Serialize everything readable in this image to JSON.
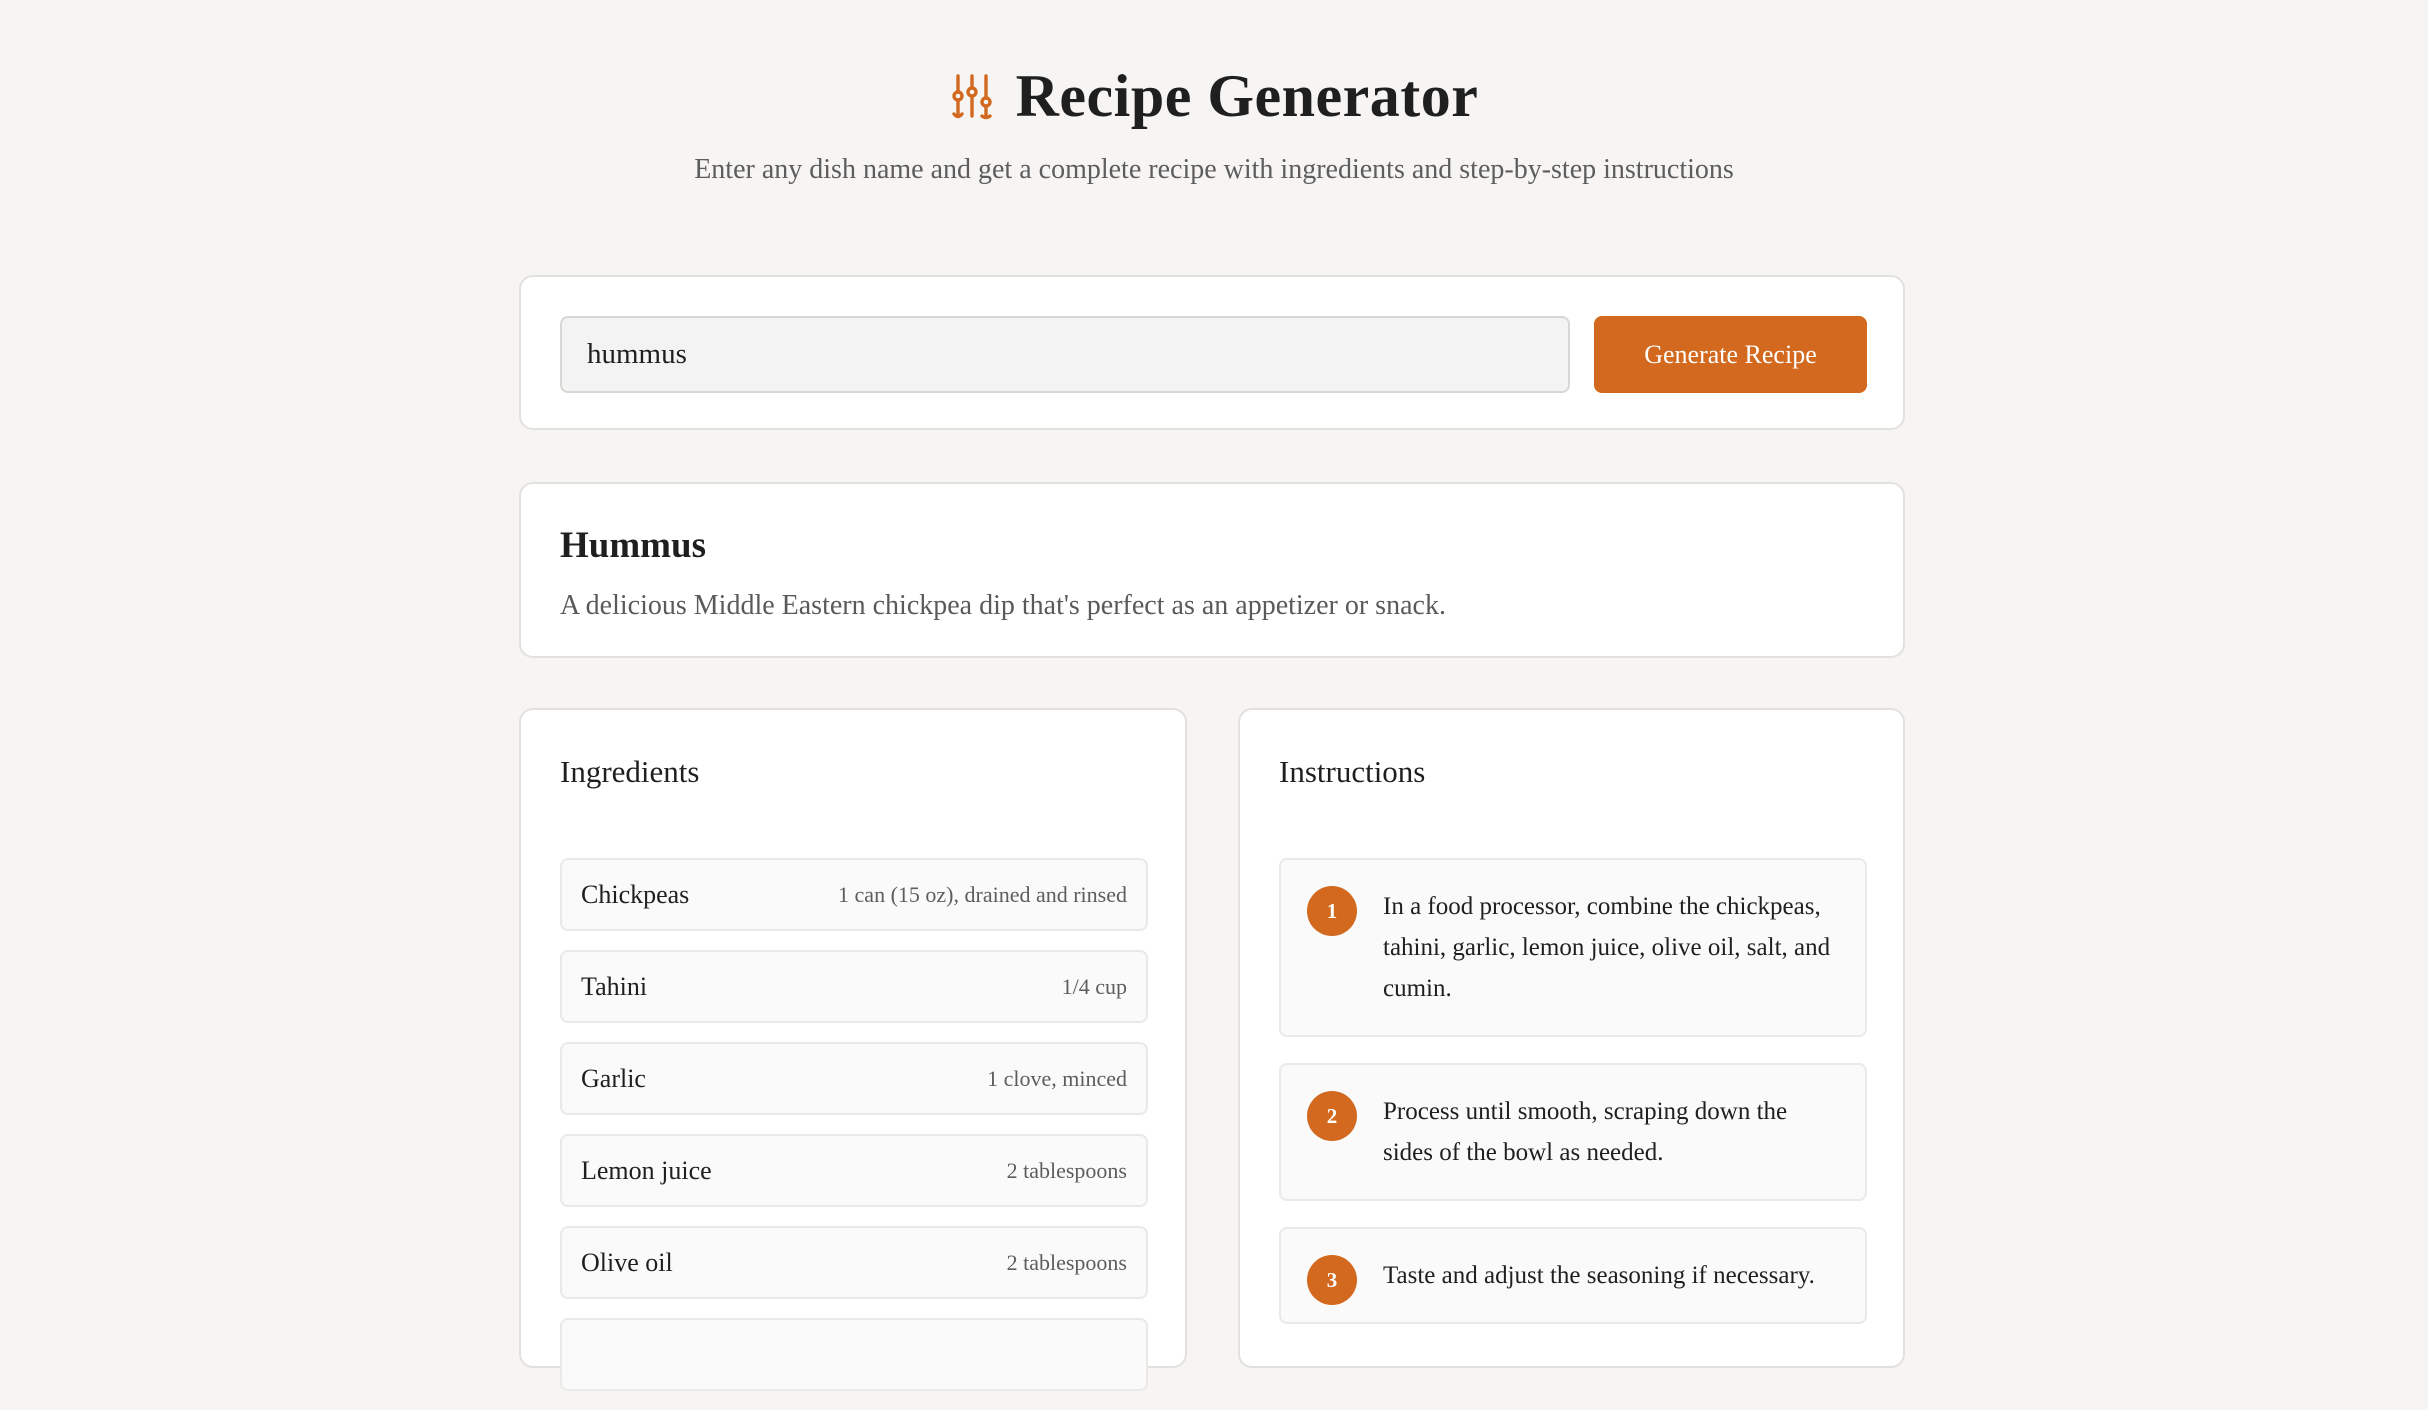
{
  "header": {
    "icon": "utensils-icon",
    "title": "Recipe Generator",
    "subtitle": "Enter any dish name and get a complete recipe with ingredients and step-by-step instructions"
  },
  "search": {
    "value": "hummus",
    "button_label": "Generate Recipe"
  },
  "recipe": {
    "name": "Hummus",
    "description": "A delicious Middle Eastern chickpea dip that's perfect as an appetizer or snack."
  },
  "ingredients": {
    "title": "Ingredients",
    "items": [
      {
        "name": "Chickpeas",
        "quantity": "1 can (15 oz), drained and rinsed"
      },
      {
        "name": "Tahini",
        "quantity": "1/4 cup"
      },
      {
        "name": "Garlic",
        "quantity": "1 clove, minced"
      },
      {
        "name": "Lemon juice",
        "quantity": "2 tablespoons"
      },
      {
        "name": "Olive oil",
        "quantity": "2 tablespoons"
      }
    ]
  },
  "instructions": {
    "title": "Instructions",
    "steps": [
      {
        "number": "1",
        "text": "In a food processor, combine the chickpeas, tahini, garlic, lemon juice, olive oil, salt, and cumin."
      },
      {
        "number": "2",
        "text": "Process until smooth, scraping down the sides of the bowl as needed."
      },
      {
        "number": "3",
        "text": "Taste and adjust the seasoning if necessary."
      }
    ]
  },
  "colors": {
    "accent": "#d2691e",
    "background": "#f6f5f3"
  }
}
